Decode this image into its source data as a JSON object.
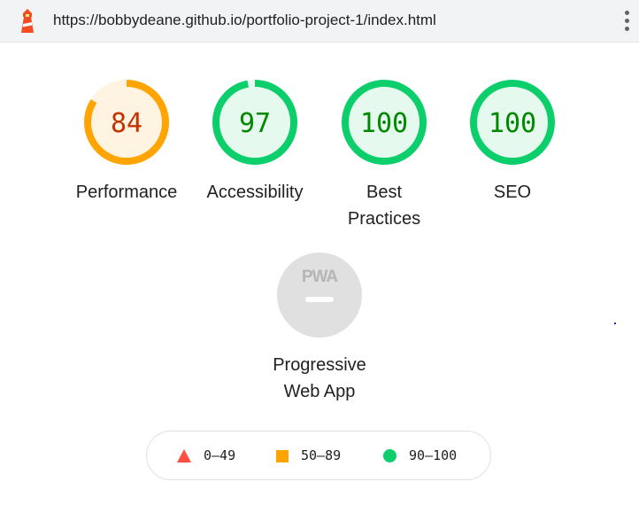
{
  "address_bar": {
    "url": "https://bobbydeane.github.io/portfolio-project-1/index.html",
    "logo_icon": "lighthouse-icon",
    "menu_icon": "more-vert-icon"
  },
  "gauges": [
    {
      "id": "performance",
      "score": "84",
      "score_fraction": 0.84,
      "label": "Performance",
      "status": "average"
    },
    {
      "id": "accessibility",
      "score": "97",
      "score_fraction": 0.97,
      "label": "Accessibility",
      "status": "pass"
    },
    {
      "id": "best-practices",
      "score": "100",
      "score_fraction": 1.0,
      "label_line1": "Best",
      "label_line2": "Practices",
      "status": "pass"
    },
    {
      "id": "seo",
      "score": "100",
      "score_fraction": 1.0,
      "label": "SEO",
      "status": "pass"
    }
  ],
  "pwa": {
    "badge_text": "PWA",
    "label_line1": "Progressive",
    "label_line2": "Web App"
  },
  "legend": {
    "fail": "0–49",
    "average": "50–89",
    "pass": "90–100"
  },
  "colors": {
    "pass": "#0cce6b",
    "pass_text": "#008800",
    "pass_bg": "#e6f9ee",
    "average": "#ffa400",
    "average_text": "#c33300",
    "average_bg": "#fff4e2",
    "fail": "#ff4e42",
    "pwa_bg": "#e0e0e0",
    "pwa_fg": "#ffffff"
  }
}
